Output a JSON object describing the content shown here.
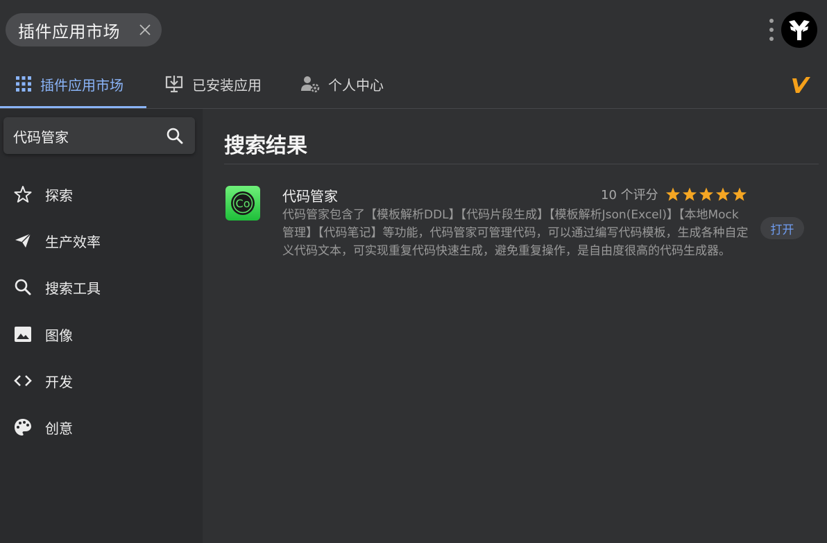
{
  "top": {
    "tag_label": "插件应用市场"
  },
  "tabs": [
    {
      "label": "插件应用市场",
      "icon": "grid-icon"
    },
    {
      "label": "已安装应用",
      "icon": "download-monitor-icon"
    },
    {
      "label": "个人中心",
      "icon": "user-settings-icon"
    }
  ],
  "search": {
    "value": "代码管家"
  },
  "sidebar": {
    "items": [
      {
        "label": "探索",
        "icon": "star-outline-icon"
      },
      {
        "label": "生产效率",
        "icon": "send-icon"
      },
      {
        "label": "搜索工具",
        "icon": "search-icon"
      },
      {
        "label": "图像",
        "icon": "image-icon"
      },
      {
        "label": "开发",
        "icon": "code-icon"
      },
      {
        "label": "创意",
        "icon": "palette-icon"
      }
    ]
  },
  "main": {
    "title": "搜索结果",
    "results": [
      {
        "name": "代码管家",
        "rating_text": "10 个评分",
        "stars": 5,
        "description": "代码管家包含了【模板解析DDL】【代码片段生成】【模板解析Json(Excel)】【本地Mock管理】【代码笔记】等功能，代码管家可管理代码，可以通过编写代码模板，生成各种自定义代码文本，可实现重复代码快速生成，避免重复操作，是自由度很高的代码生成器。",
        "button_label": "打开",
        "icon_text": "Co"
      }
    ]
  },
  "colors": {
    "accent": "#8ab4f8",
    "star": "#f5a623",
    "open_button_text": "#6f9cf0",
    "brand_v": "#f5a01a"
  }
}
